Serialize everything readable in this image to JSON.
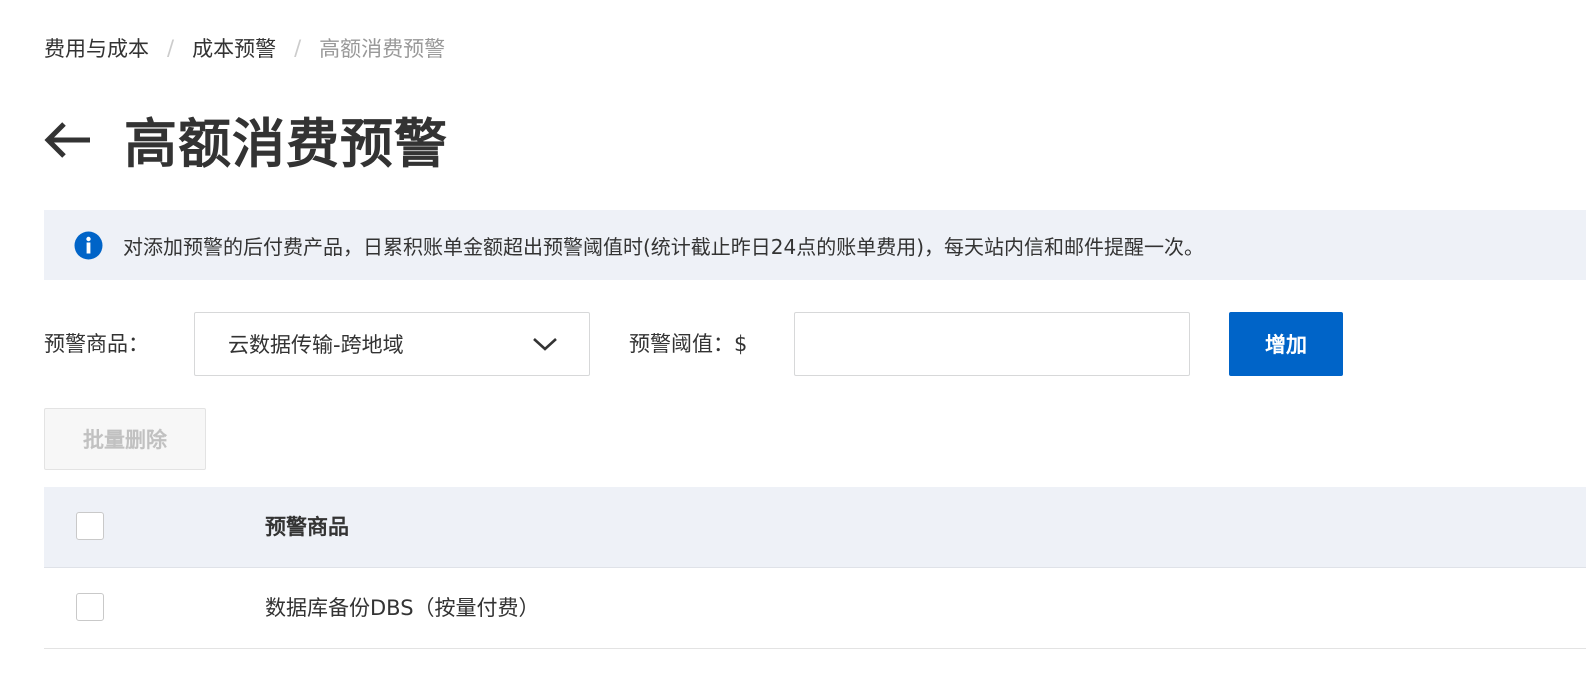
{
  "breadcrumb": {
    "items": [
      "费用与成本",
      "成本预警",
      "高额消费预警"
    ],
    "separator": "/"
  },
  "page": {
    "title": "高额消费预警",
    "back_icon": "arrow-left-icon"
  },
  "notice": {
    "icon": "info-icon",
    "text": "对添加预警的后付费产品，日累积账单金额超出预警阈值时(统计截止昨日24点的账单费用)，每天站内信和邮件提醒一次。"
  },
  "form": {
    "product_label": "预警商品：",
    "product_selected": "云数据传输-跨地域",
    "threshold_label": "预警阈值：$",
    "threshold_value": "",
    "add_label": "增加"
  },
  "toolbar": {
    "batch_delete_label": "批量删除"
  },
  "table": {
    "columns": [
      "预警商品"
    ],
    "rows": [
      {
        "product": "数据库备份DBS（按量付费）"
      }
    ]
  },
  "colors": {
    "primary": "#0064c8",
    "notice_bg": "#eef1f7",
    "text": "#333333",
    "muted": "#999999"
  }
}
